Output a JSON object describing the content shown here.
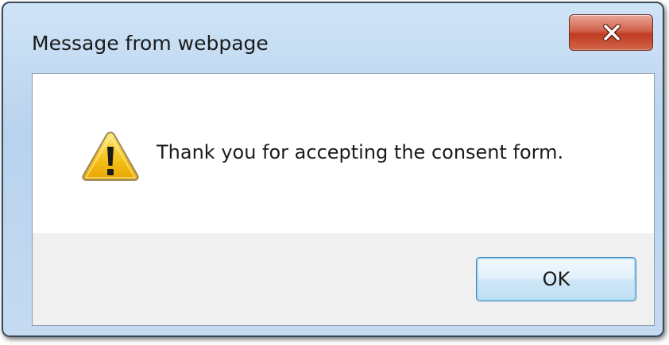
{
  "dialog": {
    "title": "Message from webpage",
    "close_label": "X",
    "message": "Thank you for accepting the consent form.",
    "ok_label": "OK"
  },
  "icons": {
    "close": "close-icon",
    "warning": "warning-icon"
  },
  "colors": {
    "title_bar": "#c4dbf2",
    "close_button": "#c9472f",
    "button_bar": "#f0f0f0",
    "ok_border": "#3c7fb1",
    "warning_yellow": "#f6c21b"
  }
}
